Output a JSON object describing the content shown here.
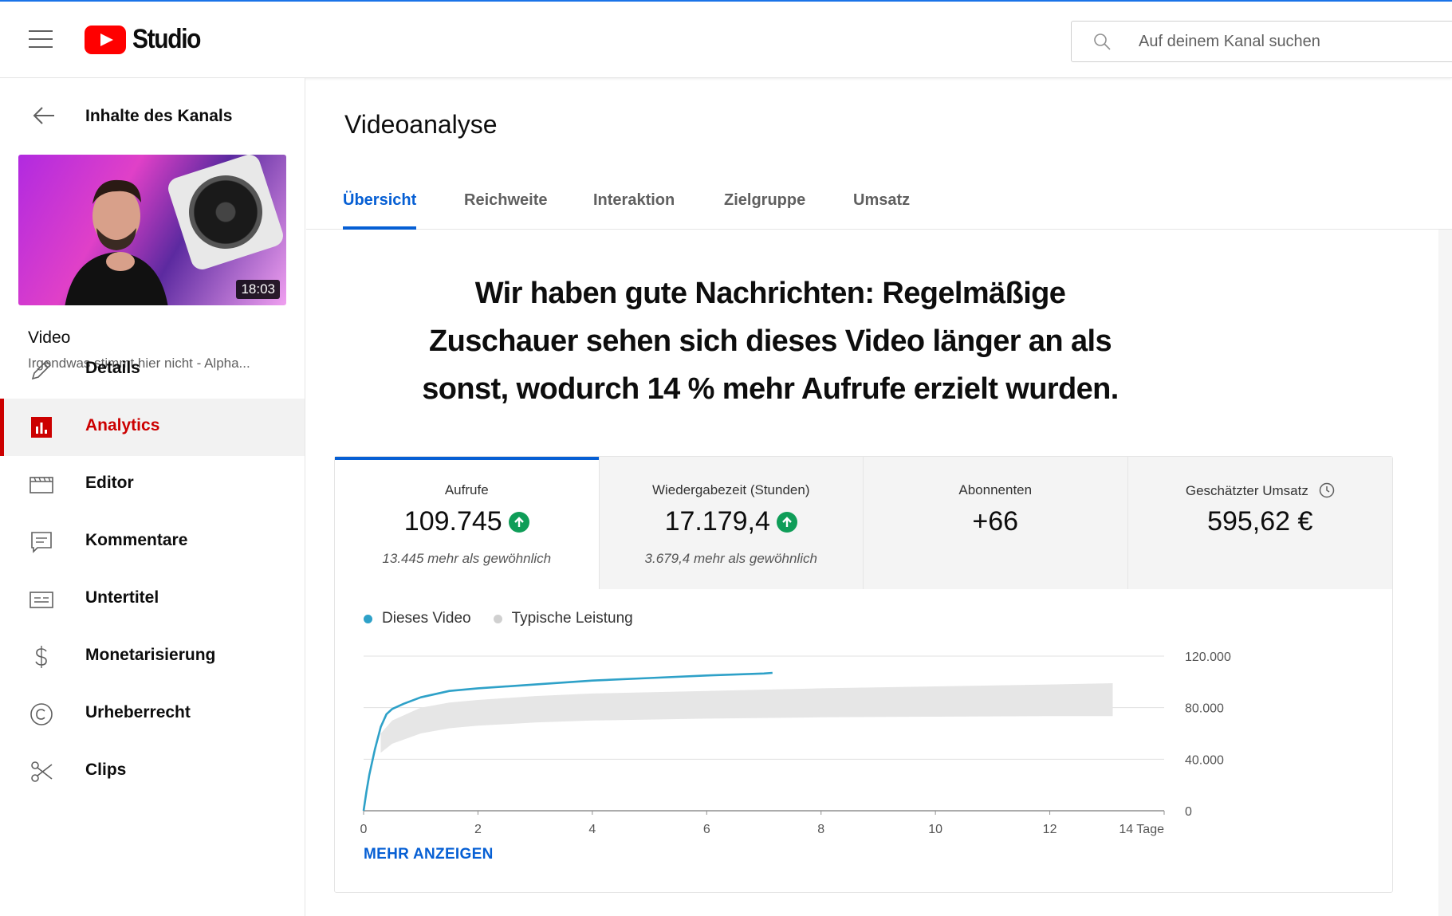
{
  "topbar": {
    "logo_text": "Studio",
    "search_placeholder": "Auf deinem Kanal suchen"
  },
  "sidebar": {
    "back_label": "Inhalte des Kanals",
    "thumbnail_duration": "18:03",
    "video_heading": "Video",
    "video_title": "Irgendwas stimmt hier nicht - Alpha...",
    "items": [
      {
        "label": "Details",
        "icon": "pencil-icon"
      },
      {
        "label": "Analytics",
        "icon": "analytics-icon",
        "active": true
      },
      {
        "label": "Editor",
        "icon": "editor-icon"
      },
      {
        "label": "Kommentare",
        "icon": "comments-icon"
      },
      {
        "label": "Untertitel",
        "icon": "subtitles-icon"
      },
      {
        "label": "Monetarisierung",
        "icon": "dollar-icon"
      },
      {
        "label": "Urheberrecht",
        "icon": "copyright-icon"
      },
      {
        "label": "Clips",
        "icon": "scissors-icon"
      }
    ]
  },
  "main": {
    "title": "Videoanalyse",
    "tabs": [
      {
        "label": "Übersicht",
        "active": true
      },
      {
        "label": "Reichweite"
      },
      {
        "label": "Interaktion"
      },
      {
        "label": "Zielgruppe"
      },
      {
        "label": "Umsatz"
      }
    ],
    "headline": "Wir haben gute Nachrichten: Regelmäßige Zuschauer sehen sich dieses Video länger an als sonst, wodurch 14 % mehr Aufrufe erzielt wurden.",
    "metrics": [
      {
        "label": "Aufrufe",
        "value": "109.745",
        "note": "13.445 mehr als gewöhnlich",
        "trend": "up"
      },
      {
        "label": "Wiedergabezeit (Stunden)",
        "value": "17.179,4",
        "note": "3.679,4 mehr als gewöhnlich",
        "trend": "up"
      },
      {
        "label": "Abonnenten",
        "value": "+66",
        "note": ""
      },
      {
        "label": "Geschätzter Umsatz",
        "value": "595,62 €",
        "note": ""
      }
    ],
    "show_more": "MEHR ANZEIGEN"
  },
  "colors": {
    "accent": "#065fd4",
    "brand_red": "#ff0000",
    "active_nav": "#cc0000",
    "series_video": "#2ea1c8",
    "series_typical": "#c8c8c8",
    "trend_up": "#0f9d58"
  },
  "chart_data": {
    "type": "area",
    "x_tick_labels": [
      "0",
      "2",
      "4",
      "6",
      "8",
      "10",
      "12",
      "14 Tage"
    ],
    "x_ticks": [
      0,
      2,
      4,
      6,
      8,
      10,
      12,
      14
    ],
    "y_tick_labels": [
      "0",
      "40.000",
      "80.000",
      "120.000"
    ],
    "y_ticks": [
      0,
      40000,
      80000,
      120000
    ],
    "xlim": [
      0,
      14
    ],
    "ylim": [
      0,
      120000
    ],
    "legend": [
      {
        "name": "Dieses Video",
        "color": "#2ea1c8"
      },
      {
        "name": "Typische Leistung",
        "color": "#c8c8c8"
      }
    ],
    "series": [
      {
        "name": "Dieses Video",
        "x": [
          0,
          0.05,
          0.1,
          0.2,
          0.3,
          0.4,
          0.5,
          0.7,
          1.0,
          1.5,
          2.0,
          3.0,
          4.0,
          5.0,
          6.0,
          7.0,
          7.15
        ],
        "y": [
          0,
          15000,
          28000,
          48000,
          65000,
          75000,
          79000,
          83000,
          88000,
          93000,
          95000,
          98000,
          101000,
          103000,
          105000,
          106500,
          107000
        ]
      },
      {
        "name": "Typische Leistung",
        "x": [
          0.3,
          0.5,
          1.0,
          1.5,
          2.0,
          3.0,
          4.0,
          6.0,
          8.0,
          10.0,
          12.0,
          13.1
        ],
        "y_low": [
          45000,
          52000,
          60000,
          64000,
          66000,
          68500,
          70000,
          71500,
          72500,
          73000,
          73500,
          73500
        ],
        "y_high": [
          60000,
          70000,
          80000,
          84000,
          86000,
          89000,
          91000,
          93000,
          95000,
          96500,
          98000,
          99000
        ]
      }
    ],
    "grid": true
  }
}
